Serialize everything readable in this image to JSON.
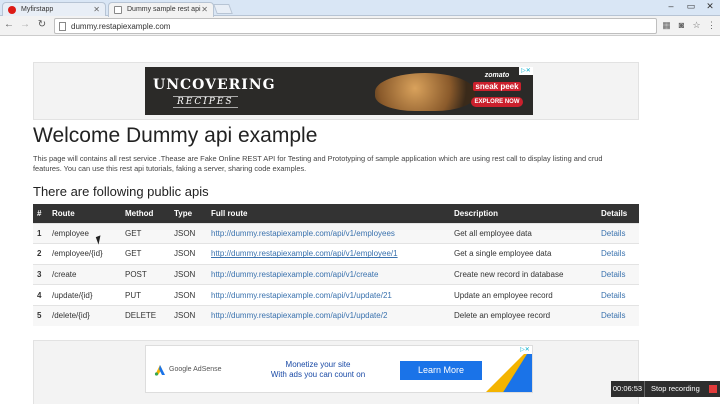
{
  "browser": {
    "tabs": [
      {
        "title": "Myfirstapp",
        "active": false,
        "favicon_color": "#dd1b16"
      },
      {
        "title": "Dummy sample rest api",
        "active": true,
        "favicon_color": "#4285f4"
      }
    ],
    "address": "dummy.restapiexample.com"
  },
  "ad_top": {
    "headline": "UNCOVERING",
    "subline": "RECIPES",
    "brand": "zomato",
    "campaign": "sneak peek",
    "cta": "EXPLORE NOW"
  },
  "page": {
    "title": "Welcome Dummy api example",
    "intro": "This page will contains all rest service .Thease are Fake Online REST API for Testing and Prototyping of sample application which are using rest call to display listing and crud features. You can use this rest api tutorials, faking a server, sharing code examples.",
    "subtitle": "There are following public apis"
  },
  "table": {
    "headers": [
      "#",
      "Route",
      "Method",
      "Type",
      "Full route",
      "Description",
      "Details"
    ],
    "rows": [
      {
        "n": "1",
        "route": "/employee",
        "method": "GET",
        "type": "JSON",
        "full": "http://dummy.restapiexample.com/api/v1/employees",
        "desc": "Get all employee data",
        "details": "Details"
      },
      {
        "n": "2",
        "route": "/employee/{id}",
        "method": "GET",
        "type": "JSON",
        "full": "http://dummy.restapiexample.com/api/v1/employee/1",
        "desc": "Get a single employee data",
        "details": "Details"
      },
      {
        "n": "3",
        "route": "/create",
        "method": "POST",
        "type": "JSON",
        "full": "http://dummy.restapiexample.com/api/v1/create",
        "desc": "Create new record in database",
        "details": "Details"
      },
      {
        "n": "4",
        "route": "/update/{id}",
        "method": "PUT",
        "type": "JSON",
        "full": "http://dummy.restapiexample.com/api/v1/update/21",
        "desc": "Update an employee record",
        "details": "Details"
      },
      {
        "n": "5",
        "route": "/delete/{id}",
        "method": "DELETE",
        "type": "JSON",
        "full": "http://dummy.restapiexample.com/api/v1/update/2",
        "desc": "Delete an employee record",
        "details": "Details"
      }
    ]
  },
  "ad_bottom": {
    "brand": "Google AdSense",
    "line1": "Monetize your site",
    "line2": "With ads you can count on",
    "cta": "Learn More"
  },
  "recorder": {
    "time": "00:06:53",
    "label": "Stop recording"
  }
}
